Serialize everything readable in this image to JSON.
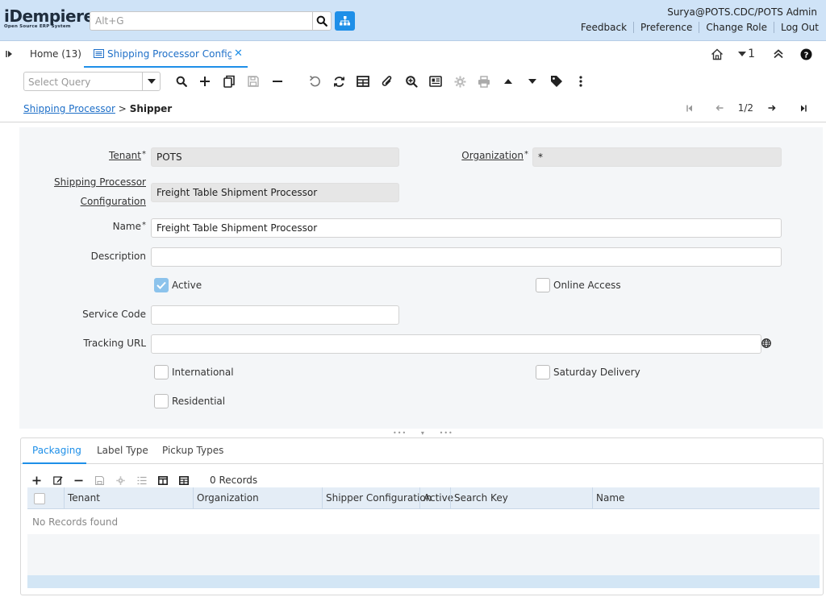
{
  "header": {
    "logo_text": "iDempiere",
    "logo_sub": "Open Source ERP System",
    "search_placeholder": "Alt+G",
    "user": "Surya@POTS.CDC/POTS Admin",
    "links": [
      "Feedback",
      "Preference",
      "Change Role",
      "Log Out"
    ]
  },
  "tabs": {
    "home": "Home (13)",
    "active": "Shipping Processor Configur...",
    "counter": "1"
  },
  "toolbar": {
    "query_placeholder": "Select Query"
  },
  "breadcrumb": {
    "parent": "Shipping Processor",
    "separator": ">",
    "current": "Shipper",
    "record_nav": "1/2"
  },
  "form": {
    "tenant_label": "Tenant",
    "tenant_value": "POTS",
    "org_label": "Organization",
    "org_value": "*",
    "spc_label_1": "Shipping Processor",
    "spc_label_2": "Configuration",
    "spc_value": "Freight Table Shipment Processor",
    "name_label": "Name",
    "name_value": "Freight Table Shipment Processor",
    "description_label": "Description",
    "description_value": "",
    "active_label": "Active",
    "online_access_label": "Online Access",
    "service_code_label": "Service Code",
    "service_code_value": "",
    "tracking_url_label": "Tracking URL",
    "tracking_url_value": "",
    "international_label": "International",
    "saturday_label": "Saturday Delivery",
    "residential_label": "Residential",
    "required_mark": "*"
  },
  "detail": {
    "tabs": [
      "Packaging",
      "Label Type",
      "Pickup Types"
    ],
    "records": "0 Records",
    "columns": [
      "Tenant",
      "Organization",
      "Shipper Configuration",
      "Active",
      "Search Key",
      "Name"
    ],
    "no_records": "No Records found"
  },
  "colors": {
    "header_bg": "#cfe3f7",
    "accent": "#1e8fe8",
    "link": "#1e6fc8"
  }
}
